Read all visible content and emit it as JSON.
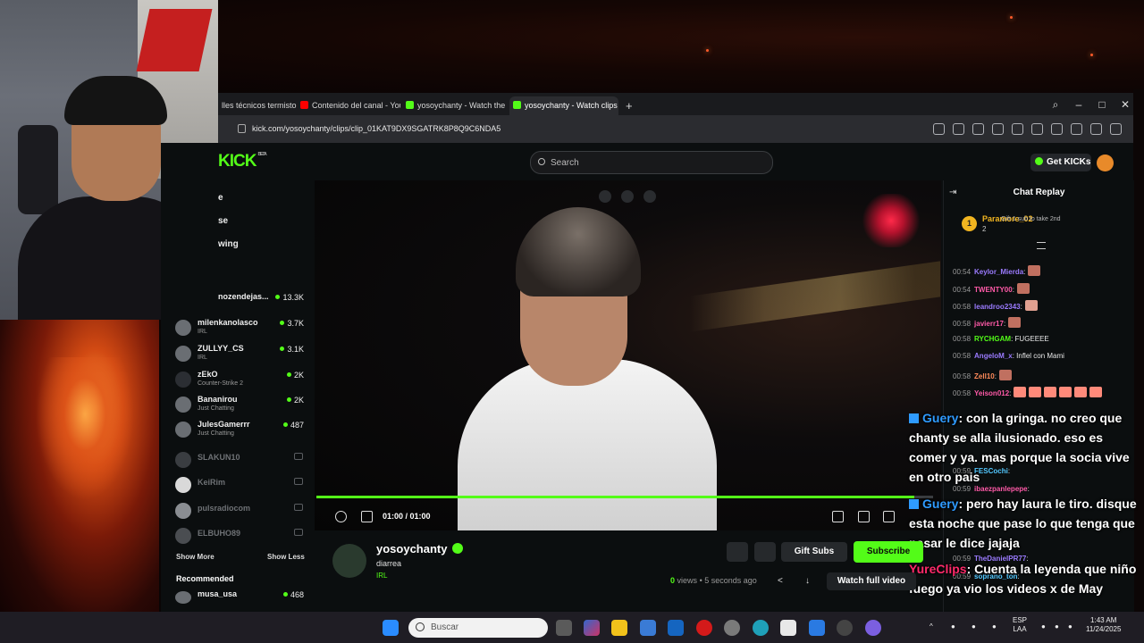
{
  "browser": {
    "tabs": [
      {
        "label": "lles técnicos termisto",
        "icon": "document-icon"
      },
      {
        "label": "Contenido del canal - You",
        "icon": "youtube-icon"
      },
      {
        "label": "yosoychanty - Watch the",
        "icon": "kick-icon"
      },
      {
        "label": "yosoychanty - Watch clips",
        "icon": "kick-icon"
      }
    ],
    "new_tab": "+",
    "url": "kick.com/yosoychanty/clips/clip_01KAT9DX9SGATRK8P8Q9C6NDA5"
  },
  "kick": {
    "logo": "KICK",
    "beta": "BETA",
    "search_placeholder": "Search",
    "get_kicks": "Get KICKs",
    "nav": [
      "e",
      "se",
      "wing"
    ],
    "following": [
      {
        "name": "nozendejas...",
        "category": "",
        "count": "13.3K",
        "live": true
      },
      {
        "name": "milenkanolasco",
        "category": "IRL",
        "count": "3.7K",
        "live": true
      },
      {
        "name": "ZULLYY_CS",
        "category": "IRL",
        "count": "3.1K",
        "live": true
      },
      {
        "name": "zEkO",
        "category": "Counter-Strike 2",
        "count": "2K",
        "live": true
      },
      {
        "name": "Bananirou",
        "category": "Just Chatting",
        "count": "2K",
        "live": true
      },
      {
        "name": "JulesGamerrr",
        "category": "Just Chatting",
        "count": "487",
        "live": true
      },
      {
        "name": "SLAKUN10",
        "category": "",
        "count": "",
        "live": false
      },
      {
        "name": "KeiRim",
        "category": "",
        "count": "",
        "live": false
      },
      {
        "name": "pulsradiocom",
        "category": "",
        "count": "",
        "live": false
      },
      {
        "name": "ELBUHO89",
        "category": "",
        "count": "",
        "live": false
      }
    ],
    "show_more": "Show More",
    "show_less": "Show Less",
    "recommended_label": "Recommended",
    "recommended": [
      {
        "name": "musa_usa",
        "count": "468"
      }
    ]
  },
  "player": {
    "time": "01:00 / 01:00",
    "progress": 0.97
  },
  "clip": {
    "channel": "yosoychanty",
    "title": "diarrea",
    "category": "IRL",
    "views_count": "0",
    "views_label": "views",
    "age": "• 5 seconds ago",
    "gift_subs": "Gift Subs",
    "subscribe": "Subscribe",
    "watch_full": "Watch full video"
  },
  "chat": {
    "title": "Chat Replay",
    "top_gifter": {
      "rank": "1",
      "name": "Paramore_02",
      "count": "2"
    },
    "gift_note": "Gift 1 sub to take 2nd",
    "messages": [
      {
        "time": "00:54",
        "user": "Keylor_Mierda",
        "text": ":",
        "color": "#9b7bff"
      },
      {
        "time": "00:54",
        "user": "TWENTY00",
        "text": ":",
        "color": "#ff5aa8"
      },
      {
        "time": "00:58",
        "user": "leandroo2343",
        "text": ":",
        "color": "#9b7bff"
      },
      {
        "time": "00:58",
        "user": "javierr17",
        "text": ":",
        "color": "#ff5aa8"
      },
      {
        "time": "00:58",
        "user": "RYCHGAM",
        "text": ": FUGEEEE",
        "color": "#53fc18"
      },
      {
        "time": "00:58",
        "user": "AngeloM_x",
        "text": ": Inflel con Mami",
        "color": "#9b7bff"
      },
      {
        "time": "00:58",
        "user": "Zell10",
        "text": ":",
        "color": "#ff8a5a"
      },
      {
        "time": "00:58",
        "user": "Yeison012",
        "text": ":",
        "color": "#ff5aa8"
      },
      {
        "time": "00:59",
        "user": "FESCochi",
        "text": ":",
        "color": "#53c8ff"
      },
      {
        "time": "00:59",
        "user": "ibaezpanlepepe",
        "text": ":",
        "color": "#ff5aa8"
      },
      {
        "time": "00:59",
        "user": "TheDanielPR77",
        "text": ":",
        "color": "#9b7bff"
      },
      {
        "time": "00:59",
        "user": "soprano_ton",
        "text": ":",
        "color": "#53c8ff"
      }
    ]
  },
  "overlay": {
    "messages": [
      {
        "user": "Guery",
        "text": ": con la gringa. no creo que chanty se alla ilusionado. eso es comer y ya. mas porque la socia vive en otro pais"
      },
      {
        "user": "Guery",
        "text": ": pero hay laura le tiro. disque esta noche que pase lo que tenga que pasar le dice jajaja"
      },
      {
        "user": "YureClips",
        "text": ": Cuenta la leyenda que niño fuego ya vio los videos x de May"
      }
    ]
  },
  "taskbar": {
    "search": "Buscar",
    "lang": "ESP",
    "region": "LAA",
    "time": "1:43 AM",
    "date": "11/24/2025"
  },
  "colors": {
    "kick_green": "#53fc18",
    "page_bg": "#0b0e0f"
  }
}
